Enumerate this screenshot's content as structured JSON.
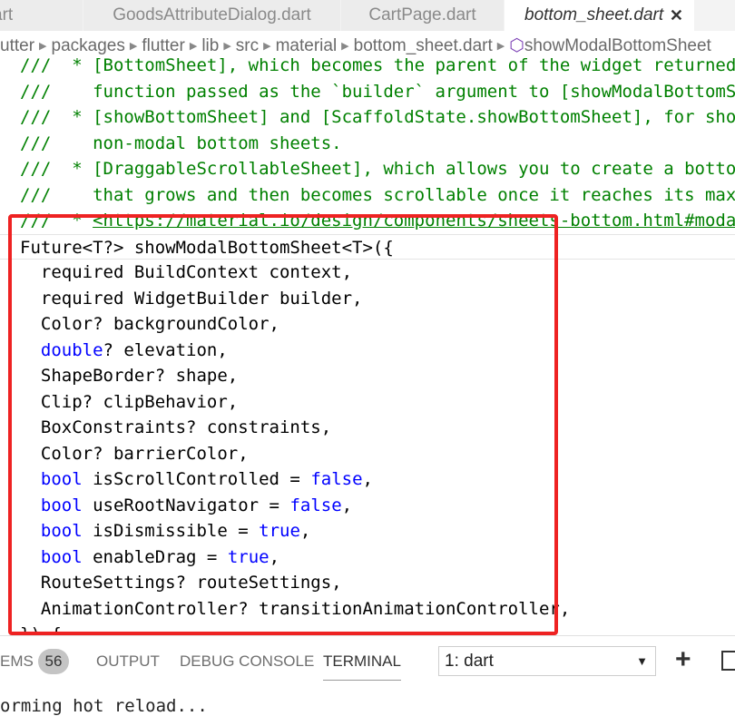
{
  "tabs": [
    {
      "label": "art"
    },
    {
      "label": "GoodsAttributeDialog.dart"
    },
    {
      "label": "CartPage.dart"
    },
    {
      "label": "bottom_sheet.dart",
      "active": true,
      "close": "✕"
    }
  ],
  "breadcrumb": [
    "utter",
    "packages",
    "flutter",
    "lib",
    "src",
    "material",
    "bottom_sheet.dart",
    "showModalBottomSheet"
  ],
  "code": [
    [
      [
        "///  * [BottomSheet], which becomes the parent of the widget returned",
        "c"
      ]
    ],
    [
      [
        "///    function passed as the `builder` argument to [showModalBottomSheet]",
        "c"
      ]
    ],
    [
      [
        "///  * [showBottomSheet] and [ScaffoldState.showBottomSheet], for showing",
        "c"
      ]
    ],
    [
      [
        "///    non-modal bottom sheets.",
        "c"
      ]
    ],
    [
      [
        "///  * [DraggableScrollableSheet], which allows you to create a bottom sheet",
        "c"
      ]
    ],
    [
      [
        "///    that grows and then becomes scrollable once it reaches its max",
        "c"
      ]
    ],
    [
      [
        "///  * ",
        "c"
      ],
      [
        "<https://material.io/design/components/sheets-bottom.html#modal>",
        "u"
      ]
    ],
    [
      [
        "Future<T?> showModalBottomSheet<T>({",
        ""
      ]
    ],
    [
      [
        "  required BuildContext context,",
        ""
      ]
    ],
    [
      [
        "  required WidgetBuilder builder,",
        ""
      ]
    ],
    [
      [
        "  Color? backgroundColor,",
        ""
      ]
    ],
    [
      [
        "  ",
        ""
      ],
      [
        "double",
        "k"
      ],
      [
        "? elevation,",
        ""
      ]
    ],
    [
      [
        "  ShapeBorder? shape,",
        ""
      ]
    ],
    [
      [
        "  Clip? clipBehavior,",
        ""
      ]
    ],
    [
      [
        "  BoxConstraints? constraints,",
        ""
      ]
    ],
    [
      [
        "  Color? barrierColor,",
        ""
      ]
    ],
    [
      [
        "  ",
        ""
      ],
      [
        "bool",
        "k"
      ],
      [
        " isScrollControlled = ",
        ""
      ],
      [
        "false",
        "k"
      ],
      [
        ",",
        ""
      ]
    ],
    [
      [
        "  ",
        ""
      ],
      [
        "bool",
        "k"
      ],
      [
        " useRootNavigator = ",
        ""
      ],
      [
        "false",
        "k"
      ],
      [
        ",",
        ""
      ]
    ],
    [
      [
        "  ",
        ""
      ],
      [
        "bool",
        "k"
      ],
      [
        " isDismissible = ",
        ""
      ],
      [
        "true",
        "k"
      ],
      [
        ",",
        ""
      ]
    ],
    [
      [
        "  ",
        ""
      ],
      [
        "bool",
        "k"
      ],
      [
        " enableDrag = ",
        ""
      ],
      [
        "true",
        "k"
      ],
      [
        ",",
        ""
      ]
    ],
    [
      [
        "  RouteSettings? routeSettings,",
        ""
      ]
    ],
    [
      [
        "  AnimationController? transitionAnimationController,",
        ""
      ]
    ],
    [
      [
        "}) {",
        ""
      ]
    ]
  ],
  "panel": {
    "problems": "EMS",
    "problems_count": "56",
    "output": "OUTPUT",
    "debug": "DEBUG CONSOLE",
    "terminal": "TERMINAL",
    "terminal_select": "1: dart",
    "terminal_text": "orming hot reload..."
  },
  "colors": {
    "highlight_box": "#ee2222",
    "comment": "#008000",
    "keyword": "#0000ff"
  }
}
